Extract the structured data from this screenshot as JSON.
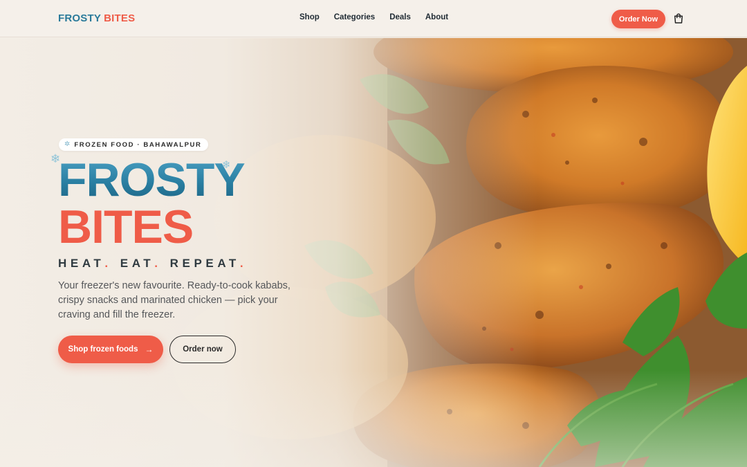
{
  "header": {
    "logo_part1": "FROSTY",
    "logo_part2": "BITES",
    "nav": [
      "Shop",
      "Categories",
      "Deals",
      "About"
    ],
    "order_button": "Order Now",
    "cart_icon": "shopping-bag-icon"
  },
  "hero": {
    "badge_icon": "✲",
    "badge_text": "FROZEN FOOD · BAHAWALPUR",
    "title_line1": "FROSTY",
    "title_line2": "BITES",
    "snowflake_glyph": "❄",
    "tagline_words": [
      "HEAT",
      "EAT",
      "REPEAT"
    ],
    "tagline_dot": ".",
    "description": "Your freezer's new favourite. Ready-to-cook kababs, crispy snacks and marinated chicken — pick your craving and fill the freezer.",
    "primary_cta": "Shop frozen foods",
    "primary_cta_arrow": "→",
    "secondary_cta": "Order now"
  },
  "colors": {
    "accent_blue": "#2a7fa2",
    "accent_coral": "#ef5c48",
    "background": "#f4efe8"
  }
}
